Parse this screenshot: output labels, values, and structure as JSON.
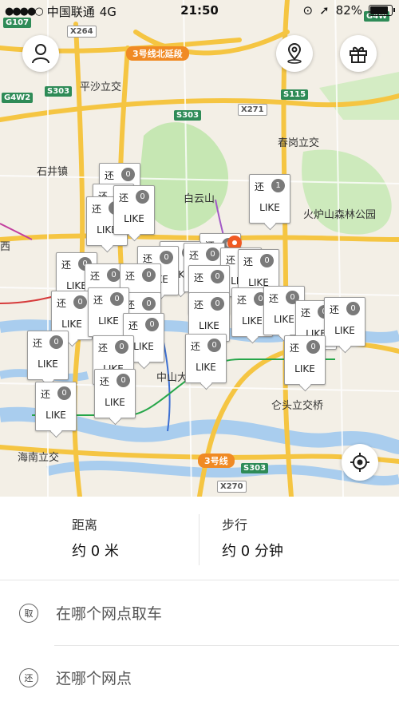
{
  "status": {
    "carrier": "中国联通",
    "network": "4G",
    "time": "21:50",
    "battery": "82%"
  },
  "map": {
    "labels": [
      "平沙立交",
      "春岗立交",
      "石井镇",
      "白云山",
      "火炉山森林公园",
      "仑头立交桥",
      "海南立交",
      "中山大学",
      "西"
    ],
    "shields": [
      "G107",
      "X264",
      "3号线北延段",
      "S303",
      "G4W2",
      "X271",
      "S115",
      "S303",
      "G4W",
      "3号线",
      "S303",
      "X270"
    ],
    "markers": [
      {
        "badge": "还",
        "count": "0",
        "label": "LIKE"
      },
      {
        "badge": "还",
        "count": "0",
        "label": "LIKE"
      },
      {
        "badge": "还",
        "count": "0",
        "label": "LIKE"
      },
      {
        "badge": "还",
        "count": "1",
        "label": "LIKE"
      },
      {
        "badge": "还",
        "count": "0",
        "label": "LIKE"
      },
      {
        "badge": "还",
        "count": "0",
        "label": "LIKE"
      },
      {
        "badge": "还",
        "count": "0",
        "label": "LIKE"
      },
      {
        "badge": "还",
        "count": "0",
        "label": "LIKE"
      },
      {
        "badge": "还",
        "count": "0",
        "label": "LIKE"
      },
      {
        "badge": "还",
        "count": "0",
        "label": "LIKE"
      },
      {
        "badge": "还",
        "count": "0",
        "label": "LIKE"
      },
      {
        "badge": "还",
        "count": "0",
        "label": "LIKE"
      },
      {
        "badge": "还",
        "count": "0",
        "label": "LIKE"
      },
      {
        "badge": "还",
        "count": "0",
        "label": "LIKE"
      },
      {
        "badge": "还",
        "count": "0",
        "label": "LIKE"
      },
      {
        "badge": "还",
        "count": "0",
        "label": "LIKE"
      },
      {
        "badge": "还",
        "count": "0",
        "label": "LIKE"
      },
      {
        "badge": "还",
        "count": "0",
        "label": "LIKE"
      },
      {
        "badge": "还",
        "count": "0",
        "label": "LIKE"
      },
      {
        "badge": "还",
        "count": "0",
        "label": "LIKE"
      },
      {
        "badge": "还",
        "count": "0",
        "label": "LIKE"
      },
      {
        "badge": "还",
        "count": "0",
        "label": "LIKE"
      },
      {
        "badge": "还",
        "count": "0",
        "label": "LIKE"
      },
      {
        "badge": "还",
        "count": "0",
        "label": "LIKE"
      },
      {
        "badge": "还",
        "count": "0",
        "label": "LIKE"
      },
      {
        "badge": "还",
        "count": "0",
        "label": "LIKE"
      },
      {
        "badge": "还",
        "count": "0",
        "label": "LIKE"
      },
      {
        "badge": "还",
        "count": "0",
        "label": "LIKE"
      },
      {
        "badge": "还",
        "count": "0",
        "label": "LIKE"
      },
      {
        "badge": "还",
        "count": "0",
        "label": "LIKE"
      }
    ]
  },
  "panel": {
    "distance_label": "距离",
    "distance_value": "约 0 米",
    "walk_label": "步行",
    "walk_value": "约 0 分钟",
    "pickup_icon": "取",
    "pickup_text": "在哪个网点取车",
    "return_icon": "还",
    "return_text": "还哪个网点"
  }
}
